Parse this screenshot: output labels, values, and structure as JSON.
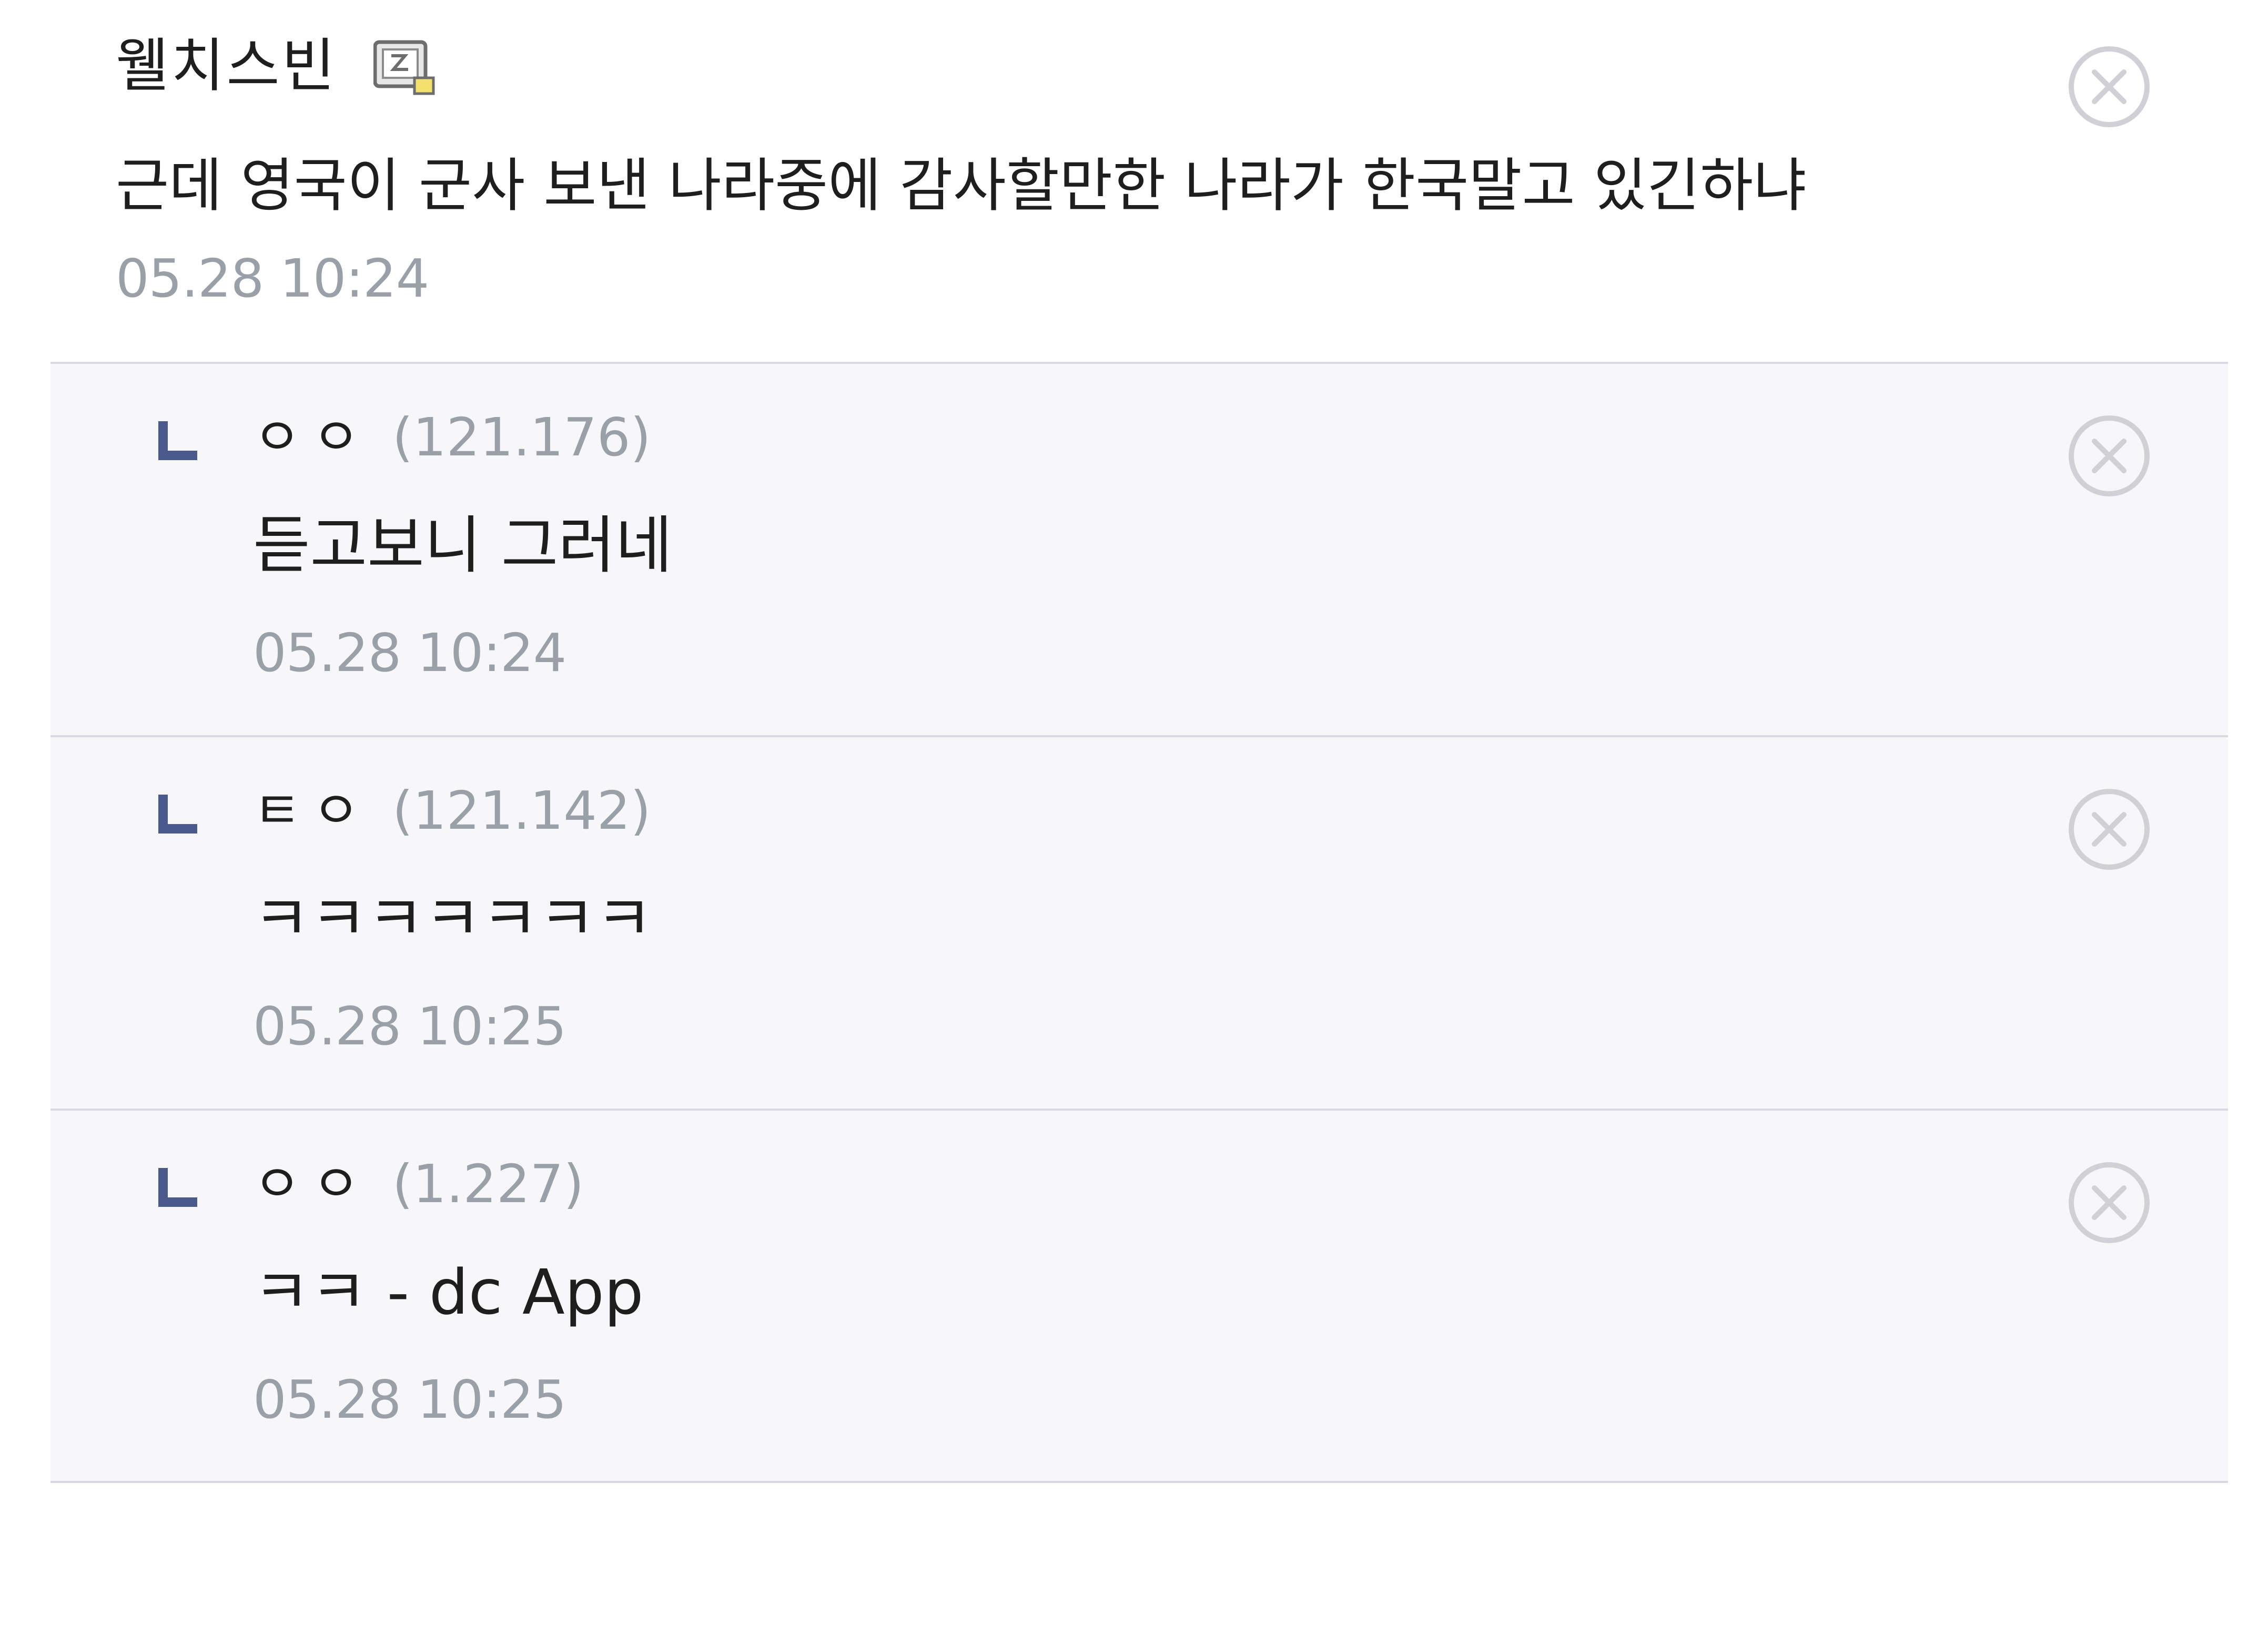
{
  "main_comment": {
    "nickname": "웰치스빈",
    "badge_icon": "mobile-user-icon",
    "text": "근데 영국이 군사 보낸 나라중에 감사할만한 나라가 한국말고 있긴하냐",
    "timestamp": "05.28 10:24",
    "delete_icon": "close-circle-icon"
  },
  "replies": [
    {
      "marker_icon": "reply-arrow-icon",
      "nickname": "ㅇㅇ",
      "ip": "(121.176)",
      "text": "듣고보니 그러네",
      "timestamp": "05.28 10:24",
      "delete_icon": "close-circle-icon"
    },
    {
      "marker_icon": "reply-arrow-icon",
      "nickname": "ㅌㅇ",
      "ip": "(121.142)",
      "text": "ㅋㅋㅋㅋㅋㅋㅋ",
      "timestamp": "05.28 10:25",
      "delete_icon": "close-circle-icon"
    },
    {
      "marker_icon": "reply-arrow-icon",
      "nickname": "ㅇㅇ",
      "ip": "(1.227)",
      "text": "ㅋㅋ - dc App",
      "timestamp": "05.28 10:25",
      "delete_icon": "close-circle-icon"
    }
  ],
  "colors": {
    "text": "#1e1e1e",
    "meta_gray": "#9aa0a8",
    "reply_background": "#f7f7fa",
    "divider": "#d9d9e2",
    "reply_marker": "#4a5a8c"
  }
}
